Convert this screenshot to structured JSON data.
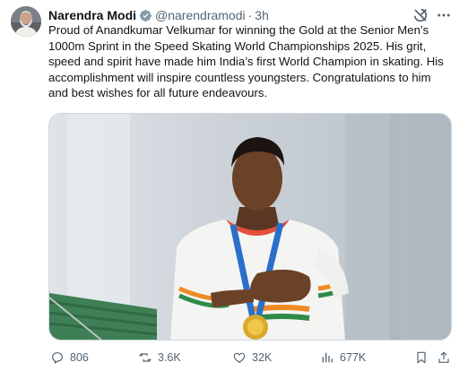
{
  "tweet": {
    "author": {
      "display_name": "Narendra Modi",
      "handle": "@narendramodi",
      "separator": "·",
      "time": "3h",
      "verified_color": "#829aab",
      "avatar_icon": "profile-photo"
    },
    "text": "Proud of Anandkumar Velkumar for winning the Gold at the Senior Men’s 1000m Sprint in the Speed Skating World Championships 2025. His grit, speed and spirit have made him India’s first World Champion in skating. His accomplishment will inspire countless youngsters. Congratulations to him and best wishes for all future endeavours.",
    "media": {
      "icon": "photo-athlete-with-gold-medal"
    },
    "actions": {
      "replies": "806",
      "reposts": "3.6K",
      "likes": "32K",
      "views": "677K"
    }
  },
  "colors": {
    "text_primary": "#0f1419",
    "text_secondary": "#536471",
    "border": "#cfd9de"
  }
}
